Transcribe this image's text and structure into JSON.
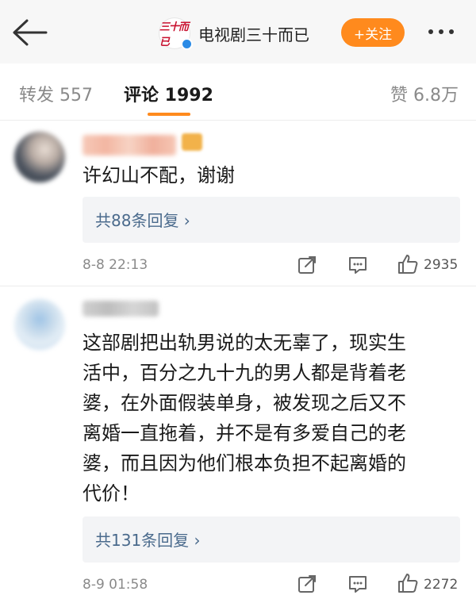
{
  "header": {
    "account_name": "电视剧三十而已",
    "logo_text": "三十而已",
    "follow_label": "+关注"
  },
  "tabs": {
    "repost": "转发 557",
    "comments": "评论 1992",
    "likes": "赞 6.8万"
  },
  "comments": [
    {
      "text": "许幻山不配，谢谢",
      "replies_label": "共88条回复 ›",
      "date": "8-8 22:13",
      "likes": "2935"
    },
    {
      "text": "这部剧把出轨男说的太无辜了，现实生\n活中，百分之九十九的男人都是背着老\n婆，在外面假装单身，被发现之后又不\n离婚一直拖着，并不是有多爱自己的老\n婆，而且因为他们根本负担不起离婚的\n代价！",
      "replies_label": "共131条回复 ›",
      "date": "8-9 01:58",
      "likes": "2272"
    }
  ],
  "colors": {
    "accent": "#ff8a1d",
    "link": "#4a6a8c"
  }
}
